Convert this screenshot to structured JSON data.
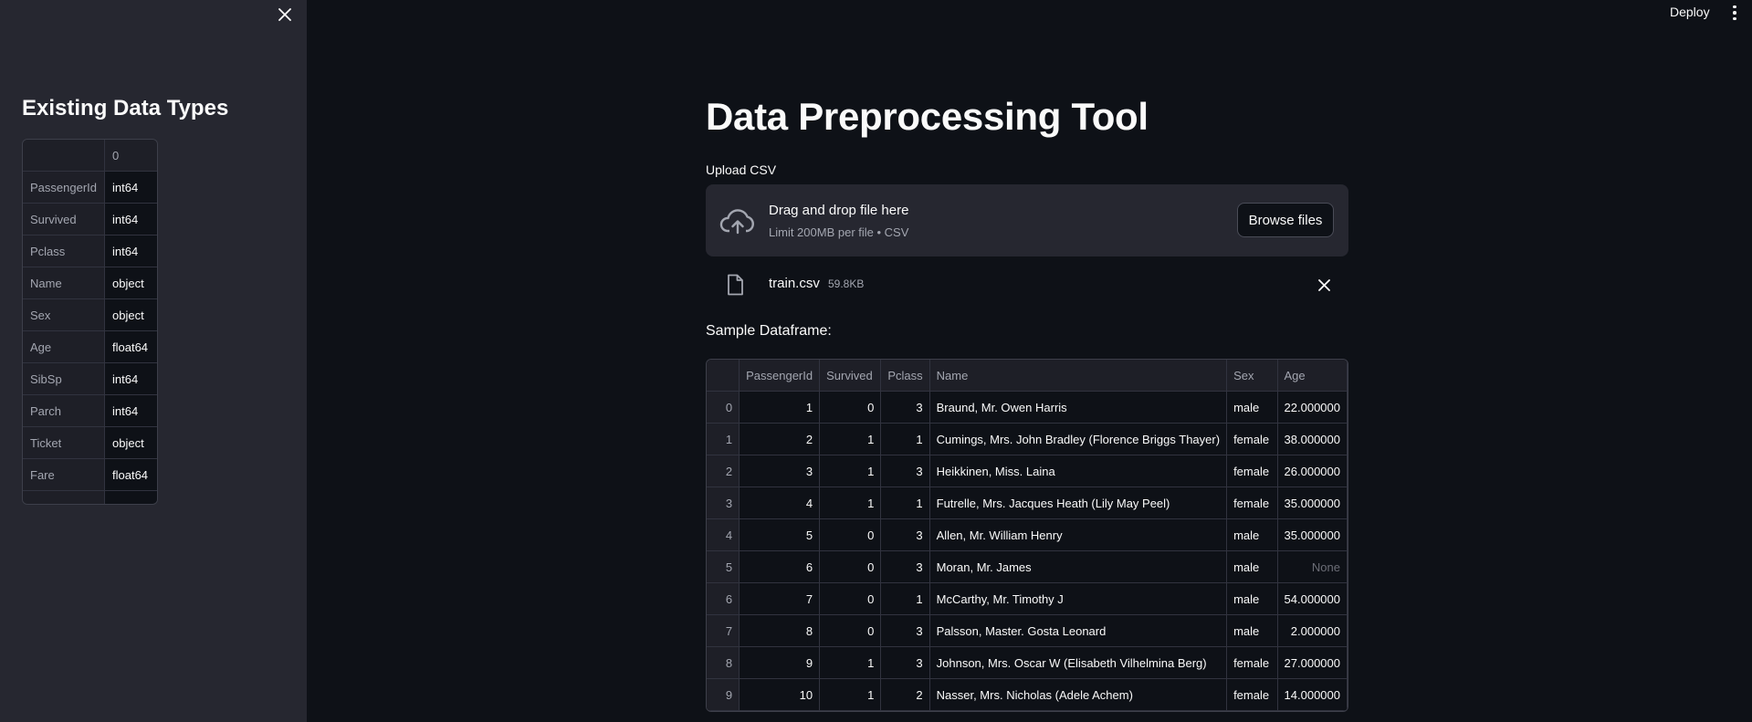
{
  "header": {
    "deploy_label": "Deploy"
  },
  "sidebar": {
    "title": "Existing Data Types",
    "table": {
      "header": [
        "",
        "0"
      ],
      "rows": [
        [
          "PassengerId",
          "int64"
        ],
        [
          "Survived",
          "int64"
        ],
        [
          "Pclass",
          "int64"
        ],
        [
          "Name",
          "object"
        ],
        [
          "Sex",
          "object"
        ],
        [
          "Age",
          "float64"
        ],
        [
          "SibSp",
          "int64"
        ],
        [
          "Parch",
          "int64"
        ],
        [
          "Ticket",
          "object"
        ],
        [
          "Fare",
          "float64"
        ]
      ]
    }
  },
  "main": {
    "title": "Data Preprocessing Tool",
    "upload": {
      "label": "Upload CSV",
      "drop_text": "Drag and drop file here",
      "limit_text": "Limit 200MB per file • CSV",
      "browse_label": "Browse files",
      "file_name": "train.csv",
      "file_size": "59.8KB"
    },
    "sample_label": "Sample Dataframe:",
    "dataframe": {
      "columns": [
        "",
        "PassengerId",
        "Survived",
        "Pclass",
        "Name",
        "Sex",
        "Age"
      ],
      "rows": [
        [
          "0",
          "1",
          "0",
          "3",
          "Braund, Mr. Owen Harris",
          "male",
          "22.000000"
        ],
        [
          "1",
          "2",
          "1",
          "1",
          "Cumings, Mrs. John Bradley (Florence Briggs Thayer)",
          "female",
          "38.000000"
        ],
        [
          "2",
          "3",
          "1",
          "3",
          "Heikkinen, Miss. Laina",
          "female",
          "26.000000"
        ],
        [
          "3",
          "4",
          "1",
          "1",
          "Futrelle, Mrs. Jacques Heath (Lily May Peel)",
          "female",
          "35.000000"
        ],
        [
          "4",
          "5",
          "0",
          "3",
          "Allen, Mr. William Henry",
          "male",
          "35.000000"
        ],
        [
          "5",
          "6",
          "0",
          "3",
          "Moran, Mr. James",
          "male",
          "None"
        ],
        [
          "6",
          "7",
          "0",
          "1",
          "McCarthy, Mr. Timothy J",
          "male",
          "54.000000"
        ],
        [
          "7",
          "8",
          "0",
          "3",
          "Palsson, Master. Gosta Leonard",
          "male",
          "2.000000"
        ],
        [
          "8",
          "9",
          "1",
          "3",
          "Johnson, Mrs. Oscar W (Elisabeth Vilhelmina Berg)",
          "female",
          "27.000000"
        ],
        [
          "9",
          "10",
          "1",
          "2",
          "Nasser, Mrs. Nicholas (Adele Achem)",
          "female",
          "14.000000"
        ]
      ]
    }
  }
}
